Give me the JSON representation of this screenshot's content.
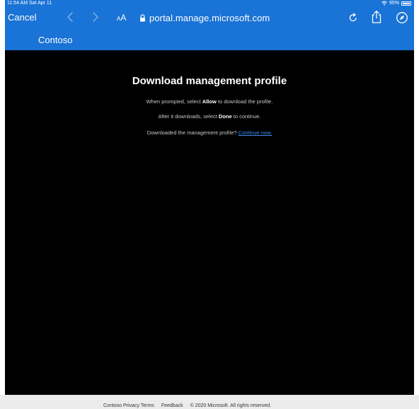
{
  "status_bar": {
    "time": "11:54 AM  Sat Apr 11",
    "battery": "95%"
  },
  "toolbar": {
    "cancel_label": "Cancel",
    "text_size_small": "A",
    "text_size_large": "A",
    "url": "portal.manage.microsoft.com"
  },
  "site": {
    "name": "Contoso"
  },
  "main": {
    "heading": "Download management profile",
    "line1_prefix": "When prompted, select ",
    "line1_bold": "Allow",
    "line1_suffix": " to download the profile.",
    "line2_prefix": "After it downloads, select ",
    "line2_bold": "Done",
    "line2_suffix": " to continue.",
    "line3_prefix": "Downloaded the management profile? ",
    "continue_link": "Continue now."
  },
  "footer": {
    "privacy": "Contoso Privacy Terms",
    "feedback": "Feedback",
    "copyright": "© 2020 Microsoft. All rights reserved."
  },
  "colors": {
    "brand_blue": "#1a73d6",
    "content_bg": "#000000",
    "link": "#3b8cf0",
    "footer_bg": "#ececec"
  },
  "icons": [
    "back-icon",
    "forward-icon",
    "lock-icon",
    "reload-icon",
    "share-icon",
    "compass-icon",
    "wifi-icon",
    "battery-icon"
  ]
}
